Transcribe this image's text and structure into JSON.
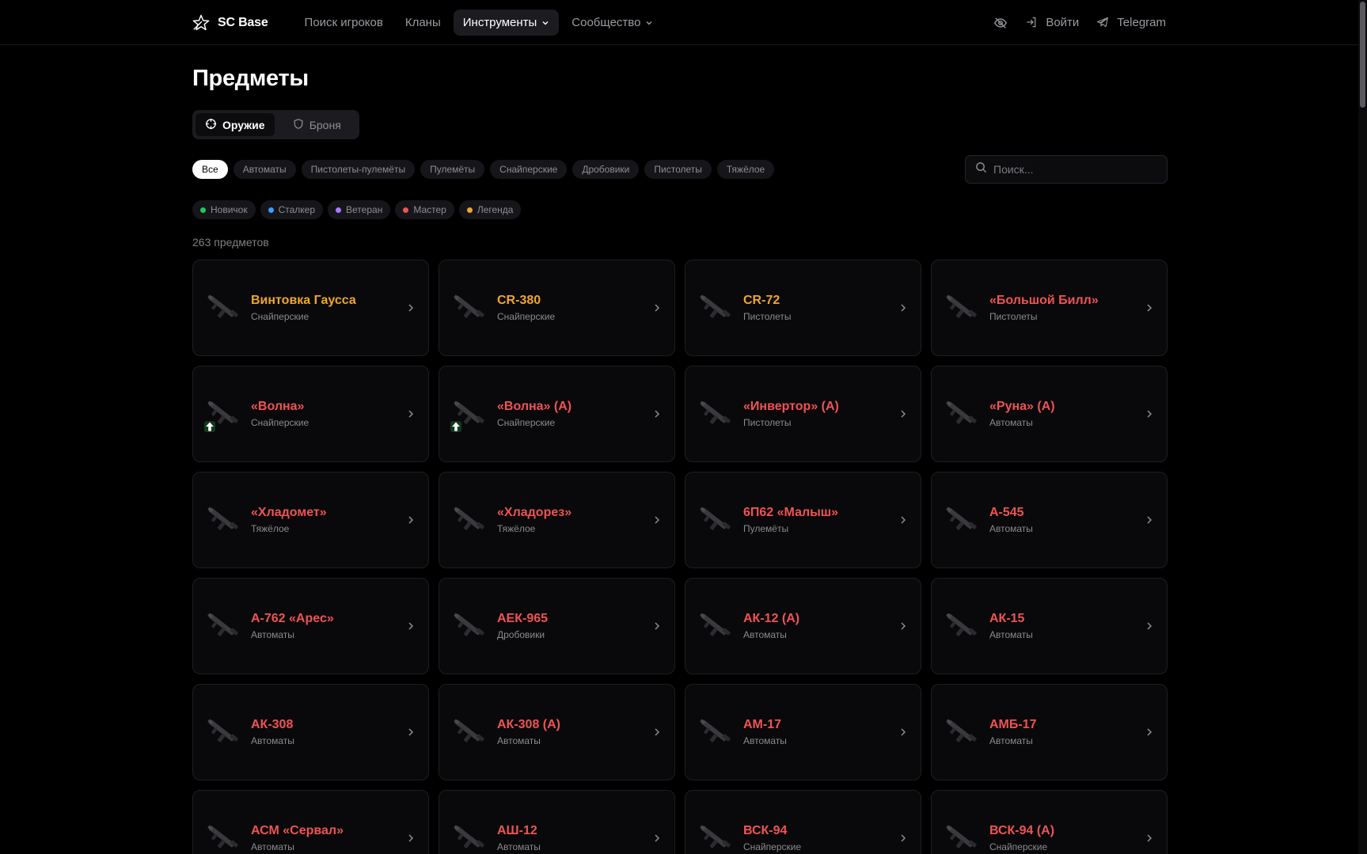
{
  "colors": {
    "legend": "#f0a52e",
    "master": "#ef5353",
    "novice": "#22c55e",
    "stalker": "#3b9eff",
    "veteran": "#a77bff"
  },
  "header": {
    "logo_text": "SC Base",
    "nav": [
      {
        "label": "Поиск игроков"
      },
      {
        "label": "Кланы"
      },
      {
        "label": "Инструменты"
      },
      {
        "label": "Сообщество"
      }
    ],
    "login_label": "Войти",
    "telegram_label": "Telegram"
  },
  "page": {
    "title": "Предметы",
    "segments": [
      {
        "label": "Оружие",
        "icon": "crosshair-icon"
      },
      {
        "label": "Броня",
        "icon": "shield-icon"
      }
    ],
    "filters": [
      "Все",
      "Автоматы",
      "Пистолеты-пулемёты",
      "Пулемёты",
      "Снайперские",
      "Дробовики",
      "Пистолеты",
      "Тяжёлое"
    ],
    "search_placeholder": "Поиск...",
    "rarities": [
      {
        "label": "Новичок",
        "color": "#22c55e"
      },
      {
        "label": "Сталкер",
        "color": "#3b9eff"
      },
      {
        "label": "Ветеран",
        "color": "#a77bff"
      },
      {
        "label": "Мастер",
        "color": "#ef5353"
      },
      {
        "label": "Легенда",
        "color": "#f0a52e"
      }
    ],
    "count_text": "263 предметов"
  },
  "items": [
    {
      "name": "Винтовка Гаусса",
      "category": "Снайперские",
      "rarity": "legend"
    },
    {
      "name": "CR-380",
      "category": "Снайперские",
      "rarity": "legend"
    },
    {
      "name": "CR-72",
      "category": "Пистолеты",
      "rarity": "legend"
    },
    {
      "name": "«Большой Билл»",
      "category": "Пистолеты",
      "rarity": "master"
    },
    {
      "name": "«Волна»",
      "category": "Снайперские",
      "rarity": "master",
      "badge": true
    },
    {
      "name": "«Волна» (А)",
      "category": "Снайперские",
      "rarity": "master",
      "badge": true
    },
    {
      "name": "«Инвертор» (А)",
      "category": "Пистолеты",
      "rarity": "master"
    },
    {
      "name": "«Руна» (А)",
      "category": "Автоматы",
      "rarity": "master"
    },
    {
      "name": "«Хладомет»",
      "category": "Тяжёлое",
      "rarity": "master"
    },
    {
      "name": "«Хладорез»",
      "category": "Тяжёлое",
      "rarity": "master"
    },
    {
      "name": "6П62 «Малыш»",
      "category": "Пулемёты",
      "rarity": "master"
    },
    {
      "name": "А-545",
      "category": "Автоматы",
      "rarity": "master"
    },
    {
      "name": "А-762 «Арес»",
      "category": "Автоматы",
      "rarity": "master"
    },
    {
      "name": "АЕК-965",
      "category": "Дробовики",
      "rarity": "master"
    },
    {
      "name": "АК-12 (А)",
      "category": "Автоматы",
      "rarity": "master"
    },
    {
      "name": "АК-15",
      "category": "Автоматы",
      "rarity": "master"
    },
    {
      "name": "АК-308",
      "category": "Автоматы",
      "rarity": "master"
    },
    {
      "name": "АК-308 (А)",
      "category": "Автоматы",
      "rarity": "master"
    },
    {
      "name": "АМ-17",
      "category": "Автоматы",
      "rarity": "master"
    },
    {
      "name": "АМБ-17",
      "category": "Автоматы",
      "rarity": "master"
    },
    {
      "name": "АСМ «Сервал»",
      "category": "Автоматы",
      "rarity": "master"
    },
    {
      "name": "АШ-12",
      "category": "Автоматы",
      "rarity": "master"
    },
    {
      "name": "ВСК-94",
      "category": "Снайперские",
      "rarity": "master"
    },
    {
      "name": "ВСК-94 (А)",
      "category": "Снайперские",
      "rarity": "master"
    }
  ]
}
